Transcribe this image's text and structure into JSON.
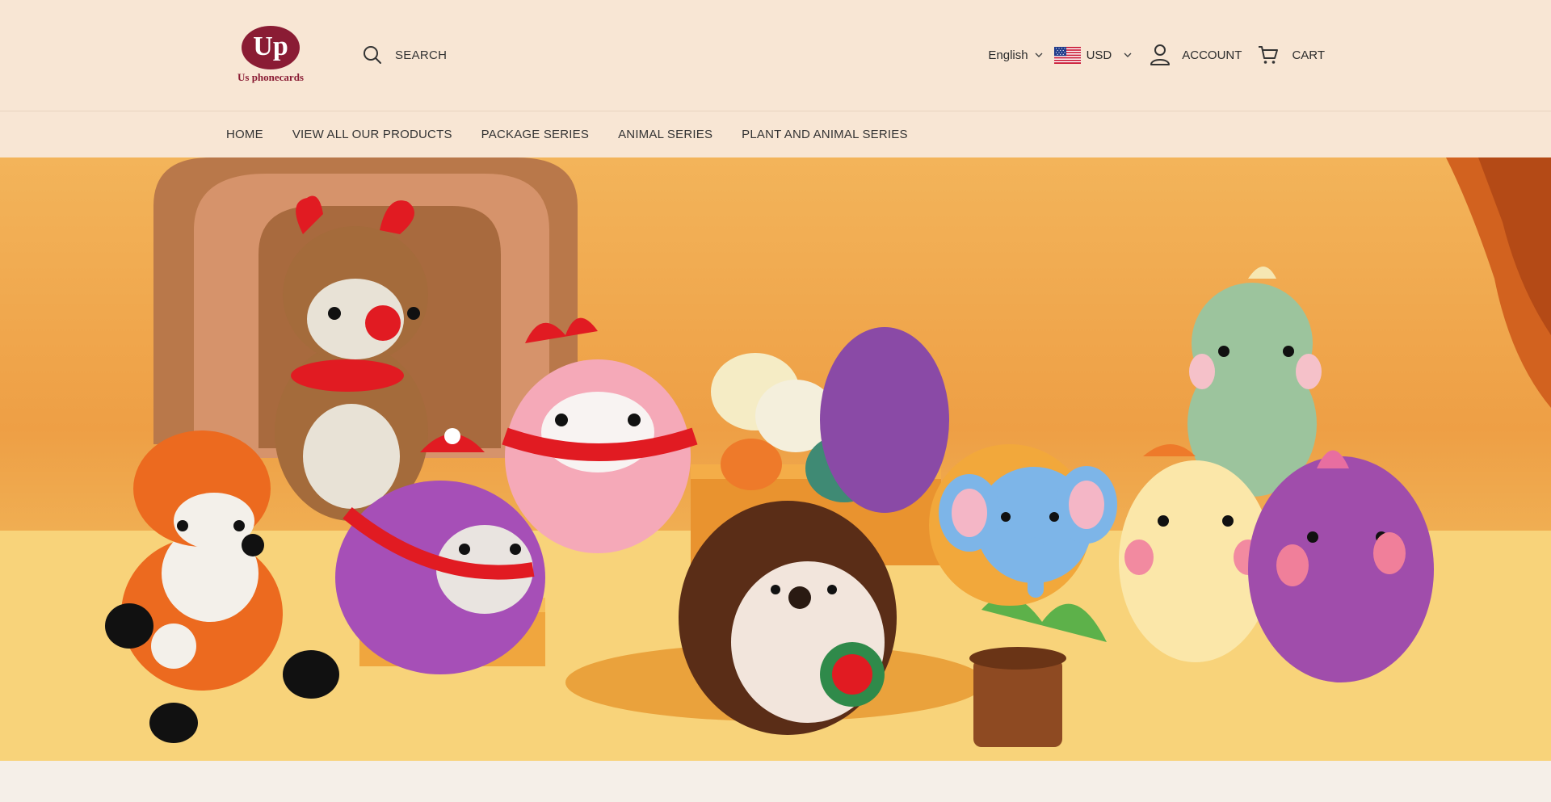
{
  "brand": {
    "logo_text": "Up",
    "logo_subtitle": "Us phonecards",
    "color": "#8a1c34"
  },
  "header": {
    "search_label": "SEARCH",
    "language": "English",
    "currency": "USD",
    "account_label": "ACCOUNT",
    "cart_label": "CART",
    "icons": [
      "search-icon",
      "chevron-down-icon",
      "us-flag-icon",
      "user-icon",
      "cart-icon"
    ]
  },
  "nav": {
    "items": [
      "HOME",
      "VIEW ALL OUR PRODUCTS",
      "PACKAGE SERIES",
      "ANIMAL SERIES",
      "PLANT AND ANIMAL SERIES"
    ]
  },
  "colors": {
    "header_bg": "#f8e6d4",
    "page_bg": "#f5efe8",
    "hero_orange": "#ee9f45"
  }
}
